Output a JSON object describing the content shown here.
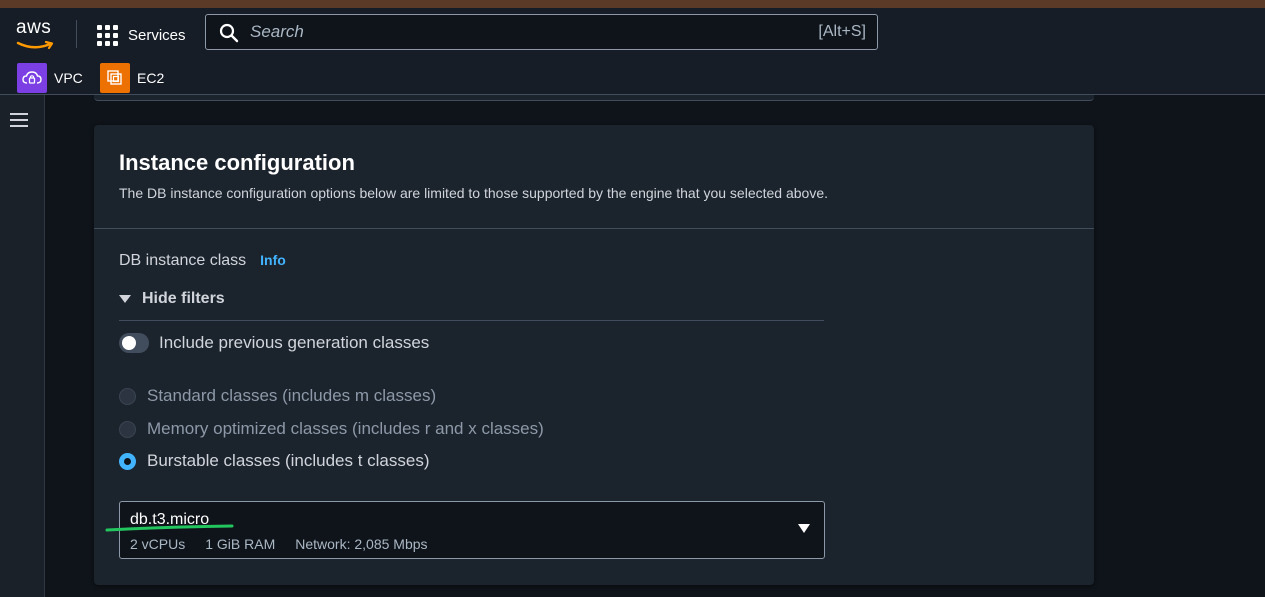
{
  "topnav": {
    "logo_text": "aws",
    "services_label": "Services",
    "search": {
      "placeholder": "Search",
      "shortcut": "[Alt+S]"
    }
  },
  "favorites": [
    {
      "label": "VPC",
      "icon": "vpc-icon",
      "color": "#7b3fe4"
    },
    {
      "label": "EC2",
      "icon": "ec2-icon",
      "color": "#ed7100"
    }
  ],
  "card": {
    "title": "Instance configuration",
    "description": "The DB instance configuration options below are limited to those supported by the engine that you selected above.",
    "field_label": "DB instance class",
    "info_label": "Info",
    "hide_filters_label": "Hide filters",
    "toggle": {
      "label": "Include previous generation classes",
      "on": false
    },
    "radios": [
      {
        "label": "Standard classes (includes m classes)",
        "disabled": true,
        "checked": false
      },
      {
        "label": "Memory optimized classes (includes r and x classes)",
        "disabled": true,
        "checked": false
      },
      {
        "label": "Burstable classes (includes t classes)",
        "disabled": false,
        "checked": true
      }
    ],
    "select": {
      "value": "db.t3.micro",
      "vcpus": "2 vCPUs",
      "ram": "1 GiB RAM",
      "network": "Network: 2,085 Mbps"
    }
  },
  "colors": {
    "accent": "#42b4ff",
    "annotation": "#22c55e"
  }
}
